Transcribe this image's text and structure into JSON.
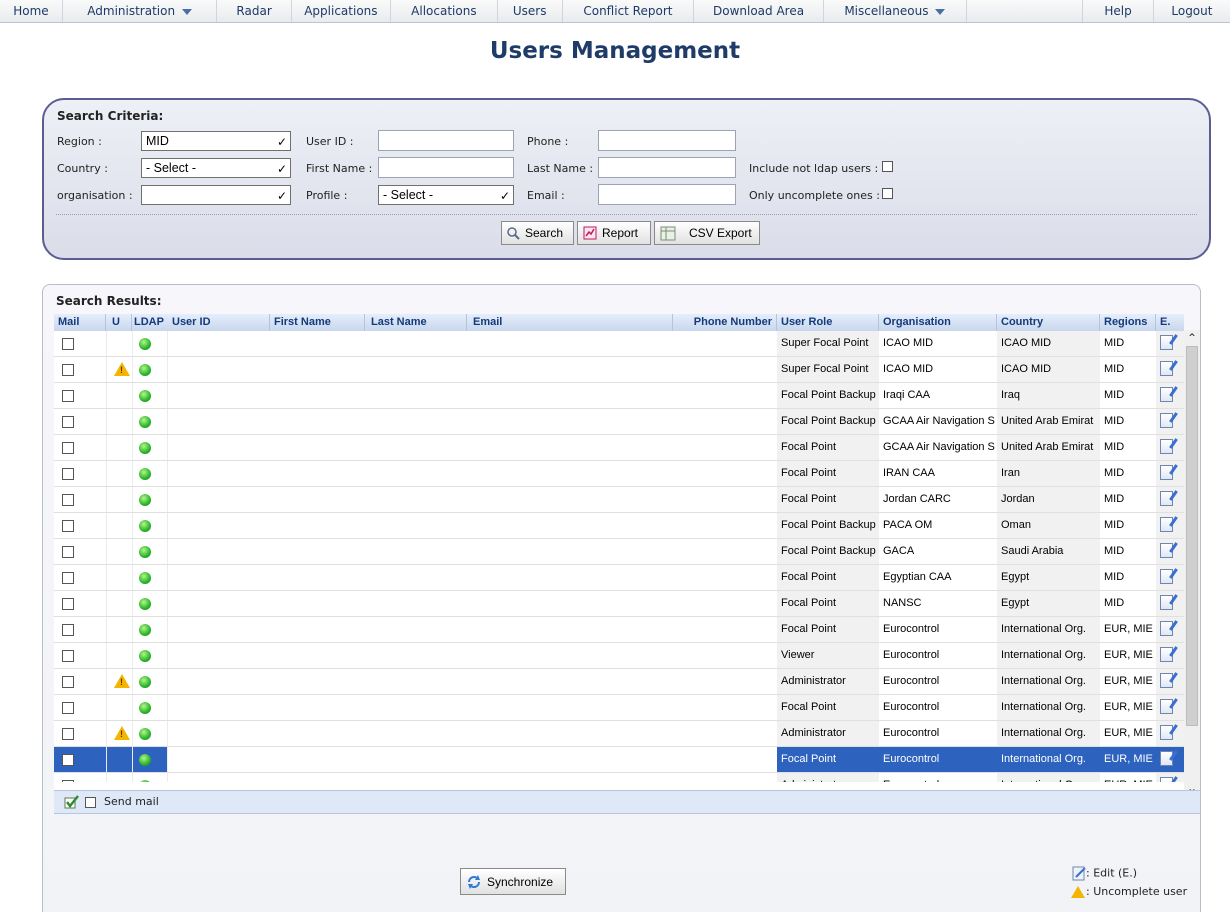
{
  "nav": {
    "items": [
      {
        "label": "Home",
        "dropdown": false
      },
      {
        "label": "Administration",
        "dropdown": true
      },
      {
        "label": "Radar",
        "dropdown": false
      },
      {
        "label": "Applications",
        "dropdown": false
      },
      {
        "label": "Allocations",
        "dropdown": false
      },
      {
        "label": "Users",
        "dropdown": false
      },
      {
        "label": "Conflict Report",
        "dropdown": false
      },
      {
        "label": "Download Area",
        "dropdown": false
      },
      {
        "label": "Miscellaneous",
        "dropdown": true
      },
      {
        "label": "Help",
        "dropdown": false
      },
      {
        "label": "Logout",
        "dropdown": false
      }
    ]
  },
  "page_title": "Users Management",
  "search": {
    "heading": "Search Criteria:",
    "region_label": "Region :",
    "region_value": "MID",
    "country_label": "Country :",
    "country_value": "- Select -",
    "organisation_label": "organisation :",
    "organisation_value": "",
    "userid_label": "User ID :",
    "firstname_label": "First Name :",
    "profile_label": "Profile :",
    "profile_value": "- Select -",
    "phone_label": "Phone :",
    "lastname_label": "Last Name :",
    "email_label": "Email :",
    "include_label": "Include not ldap users :",
    "only_label": "Only uncomplete ones :",
    "btn_search": "Search",
    "btn_report": "Report",
    "btn_csv": "CSV Export"
  },
  "results": {
    "heading": "Search Results:",
    "columns": [
      "Mail",
      "U",
      "LDAP",
      "User ID",
      "First Name",
      "Last Name",
      "Email",
      "Phone Number",
      "User Role",
      "Organisation",
      "Country",
      "Regions",
      "E."
    ],
    "rows": [
      {
        "role": "Super Focal Point",
        "org": "ICAO MID",
        "country": "ICAO MID",
        "regions": "MID",
        "warn": false,
        "selected": false
      },
      {
        "role": "Super Focal Point",
        "org": "ICAO MID",
        "country": "ICAO MID",
        "regions": "MID",
        "warn": true,
        "selected": false
      },
      {
        "role": "Focal Point Backup",
        "org": "Iraqi CAA",
        "country": "Iraq",
        "regions": "MID",
        "warn": false,
        "selected": false
      },
      {
        "role": "Focal Point Backup",
        "org": "GCAA Air Navigation S",
        "country": "United Arab Emirat",
        "regions": "MID",
        "warn": false,
        "selected": false
      },
      {
        "role": "Focal Point",
        "org": "GCAA Air Navigation S",
        "country": "United Arab Emirat",
        "regions": "MID",
        "warn": false,
        "selected": false
      },
      {
        "role": "Focal Point",
        "org": "IRAN CAA",
        "country": "Iran",
        "regions": "MID",
        "warn": false,
        "selected": false
      },
      {
        "role": "Focal Point",
        "org": "Jordan CARC",
        "country": "Jordan",
        "regions": "MID",
        "warn": false,
        "selected": false
      },
      {
        "role": "Focal Point Backup",
        "org": "PACA OM",
        "country": "Oman",
        "regions": "MID",
        "warn": false,
        "selected": false
      },
      {
        "role": "Focal Point Backup",
        "org": "GACA",
        "country": "Saudi Arabia",
        "regions": "MID",
        "warn": false,
        "selected": false
      },
      {
        "role": "Focal Point",
        "org": "Egyptian CAA",
        "country": "Egypt",
        "regions": "MID",
        "warn": false,
        "selected": false
      },
      {
        "role": "Focal Point",
        "org": "NANSC",
        "country": "Egypt",
        "regions": "MID",
        "warn": false,
        "selected": false
      },
      {
        "role": "Focal Point",
        "org": "Eurocontrol",
        "country": "International Org.",
        "regions": "EUR, MIE",
        "warn": false,
        "selected": false
      },
      {
        "role": "Viewer",
        "org": "Eurocontrol",
        "country": "International Org.",
        "regions": "EUR, MIE",
        "warn": false,
        "selected": false
      },
      {
        "role": "Administrator",
        "org": "Eurocontrol",
        "country": "International Org.",
        "regions": "EUR, MIE",
        "warn": true,
        "selected": false
      },
      {
        "role": "Focal Point",
        "org": "Eurocontrol",
        "country": "International Org.",
        "regions": "EUR, MIE",
        "warn": false,
        "selected": false
      },
      {
        "role": "Administrator",
        "org": "Eurocontrol",
        "country": "International Org.",
        "regions": "EUR, MIE",
        "warn": true,
        "selected": false
      },
      {
        "role": "Focal Point",
        "org": "Eurocontrol",
        "country": "International Org.",
        "regions": "EUR, MIE",
        "warn": false,
        "selected": true
      },
      {
        "role": "Administrator",
        "org": "Eurocontrol",
        "country": "International Org.",
        "regions": "EUR, MIE",
        "warn": false,
        "selected": false
      }
    ],
    "send_mail_label": "Send mail",
    "synchronize_label": "Synchronize",
    "legend_edit": ": Edit (E.)",
    "legend_uncomplete": ": Uncomplete user"
  },
  "colors": {
    "nav_text": "#1e3a66",
    "title": "#1f3b68",
    "panel_border": "#5c5c91",
    "selection": "#2d63be",
    "ldap_ok": "#29b42a",
    "warning": "#f4b400"
  },
  "icons": [
    "caret-down-icon",
    "search-icon",
    "report-icon",
    "csv-icon",
    "ldap-status-icon",
    "warning-icon",
    "edit-icon",
    "check-icon",
    "sync-icon"
  ]
}
